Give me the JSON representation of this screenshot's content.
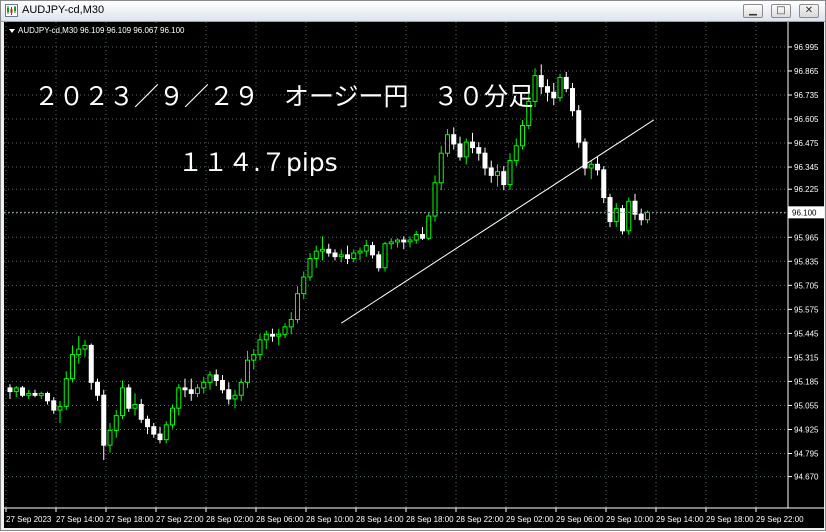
{
  "window": {
    "title": "AUDJPY-cd,M30",
    "buttons": {
      "minimize": "▁",
      "maximize": "□",
      "close": "✕"
    }
  },
  "chart_header": "AUDJPY-cd,M30  96.109 96.109 96.067 96.100",
  "annotations": {
    "title": "２０２３／９／２９　オージー円　３０分足",
    "pips": "１１４.７pips"
  },
  "colors": {
    "background": "#000000",
    "bull": "#00ff00",
    "bear": "#ffffff",
    "grid": "#5a6a6a",
    "axis_text": "#ffffff",
    "current_price_line": "#8a9aa0"
  },
  "chart_data": {
    "type": "candlestick",
    "symbol": "AUDJPY-cd",
    "timeframe": "M30",
    "ylim": [
      94.7,
      97.0
    ],
    "y_ticks": [
      "96.995",
      "96.865",
      "96.735",
      "96.605",
      "96.475",
      "96.345",
      "96.225",
      "96.095",
      "95.965",
      "95.835",
      "95.705",
      "95.575",
      "95.445",
      "95.315",
      "95.185",
      "95.055",
      "94.925",
      "94.795",
      "94.670"
    ],
    "x_ticks": [
      "27 Sep 2023",
      "27 Sep 14:00",
      "27 Sep 18:00",
      "27 Sep 22:00",
      "28 Sep 02:00",
      "28 Sep 06:00",
      "28 Sep 10:00",
      "28 Sep 14:00",
      "28 Sep 18:00",
      "28 Sep 22:00",
      "29 Sep 02:00",
      "29 Sep 06:00",
      "29 Sep 10:00",
      "29 Sep 14:00",
      "29 Sep 18:00",
      "29 Sep 22:00"
    ],
    "current_price": "96.100",
    "trend_line": {
      "from": {
        "time": "28 Sep 14:30",
        "price": 95.5
      },
      "to": {
        "time": "29 Sep 15:30",
        "price": 96.6
      }
    },
    "ohlc": [
      [
        95.15,
        95.17,
        95.09,
        95.13
      ],
      [
        95.13,
        95.16,
        95.1,
        95.15
      ],
      [
        95.15,
        95.16,
        95.1,
        95.11
      ],
      [
        95.11,
        95.14,
        95.09,
        95.12
      ],
      [
        95.12,
        95.14,
        95.1,
        95.11
      ],
      [
        95.11,
        95.13,
        95.09,
        95.12
      ],
      [
        95.12,
        95.13,
        95.06,
        95.08
      ],
      [
        95.08,
        95.1,
        95.01,
        95.03
      ],
      [
        95.03,
        95.08,
        94.96,
        95.05
      ],
      [
        95.05,
        95.24,
        95.03,
        95.2
      ],
      [
        95.2,
        95.38,
        95.18,
        95.33
      ],
      [
        95.33,
        95.43,
        95.28,
        95.36
      ],
      [
        95.36,
        95.41,
        95.32,
        95.38
      ],
      [
        95.38,
        95.39,
        95.14,
        95.18
      ],
      [
        95.18,
        95.2,
        95.08,
        95.11
      ],
      [
        95.11,
        95.14,
        94.76,
        94.84
      ],
      [
        94.84,
        94.96,
        94.8,
        94.92
      ],
      [
        94.92,
        95.03,
        94.88,
        95.0
      ],
      [
        95.0,
        95.19,
        94.98,
        95.15
      ],
      [
        95.15,
        95.17,
        95.02,
        95.04
      ],
      [
        95.04,
        95.12,
        95.0,
        95.06
      ],
      [
        95.06,
        95.09,
        94.96,
        94.98
      ],
      [
        94.98,
        95.0,
        94.9,
        94.94
      ],
      [
        94.94,
        94.96,
        94.88,
        94.9
      ],
      [
        94.9,
        94.94,
        94.85,
        94.87
      ],
      [
        94.87,
        94.97,
        94.85,
        94.95
      ],
      [
        94.95,
        95.06,
        94.93,
        95.04
      ],
      [
        95.04,
        95.17,
        95.0,
        95.15
      ],
      [
        95.15,
        95.2,
        95.1,
        95.14
      ],
      [
        95.14,
        95.2,
        95.08,
        95.12
      ],
      [
        95.12,
        95.17,
        95.1,
        95.15
      ],
      [
        95.15,
        95.21,
        95.12,
        95.18
      ],
      [
        95.18,
        95.24,
        95.14,
        95.22
      ],
      [
        95.22,
        95.25,
        95.16,
        95.19
      ],
      [
        95.19,
        95.22,
        95.12,
        95.14
      ],
      [
        95.14,
        95.18,
        95.06,
        95.09
      ],
      [
        95.09,
        95.14,
        95.04,
        95.11
      ],
      [
        95.11,
        95.2,
        95.08,
        95.18
      ],
      [
        95.18,
        95.35,
        95.15,
        95.3
      ],
      [
        95.3,
        95.36,
        95.25,
        95.33
      ],
      [
        95.33,
        95.44,
        95.3,
        95.41
      ],
      [
        95.41,
        95.46,
        95.36,
        95.44
      ],
      [
        95.44,
        95.47,
        95.4,
        95.43
      ],
      [
        95.43,
        95.47,
        95.38,
        95.44
      ],
      [
        95.44,
        95.5,
        95.42,
        95.48
      ],
      [
        95.48,
        95.56,
        95.44,
        95.52
      ],
      [
        95.52,
        95.7,
        95.5,
        95.66
      ],
      [
        95.66,
        95.78,
        95.63,
        95.75
      ],
      [
        95.75,
        95.88,
        95.73,
        95.85
      ],
      [
        95.85,
        95.92,
        95.8,
        95.89
      ],
      [
        95.89,
        95.97,
        95.84,
        95.9
      ],
      [
        95.9,
        95.93,
        95.86,
        95.88
      ],
      [
        95.88,
        95.9,
        95.84,
        95.86
      ],
      [
        95.86,
        95.9,
        95.83,
        95.87
      ],
      [
        95.87,
        95.92,
        95.82,
        95.85
      ],
      [
        95.85,
        95.9,
        95.83,
        95.88
      ],
      [
        95.88,
        95.91,
        95.84,
        95.89
      ],
      [
        95.89,
        95.95,
        95.86,
        95.92
      ],
      [
        95.92,
        95.94,
        95.85,
        95.87
      ],
      [
        95.87,
        95.89,
        95.78,
        95.8
      ],
      [
        95.8,
        95.94,
        95.78,
        95.93
      ],
      [
        95.93,
        95.96,
        95.9,
        95.94
      ],
      [
        95.94,
        95.96,
        95.91,
        95.95
      ],
      [
        95.95,
        95.97,
        95.9,
        95.94
      ],
      [
        95.94,
        95.97,
        95.91,
        95.95
      ],
      [
        95.95,
        96.0,
        95.93,
        95.98
      ],
      [
        95.98,
        96.02,
        95.95,
        95.96
      ],
      [
        95.96,
        96.1,
        95.95,
        96.08
      ],
      [
        96.08,
        96.3,
        96.05,
        96.26
      ],
      [
        96.26,
        96.46,
        96.22,
        96.42
      ],
      [
        96.42,
        96.55,
        96.4,
        96.52
      ],
      [
        96.52,
        96.56,
        96.44,
        96.47
      ],
      [
        96.47,
        96.51,
        96.38,
        96.4
      ],
      [
        96.4,
        96.5,
        96.36,
        96.48
      ],
      [
        96.48,
        96.53,
        96.42,
        96.45
      ],
      [
        96.45,
        96.48,
        96.38,
        96.42
      ],
      [
        96.42,
        96.45,
        96.3,
        96.34
      ],
      [
        96.34,
        96.38,
        96.26,
        96.3
      ],
      [
        96.3,
        96.36,
        96.24,
        96.32
      ],
      [
        96.32,
        96.35,
        96.22,
        96.25
      ],
      [
        96.25,
        96.42,
        96.22,
        96.38
      ],
      [
        96.38,
        96.5,
        96.35,
        96.46
      ],
      [
        96.46,
        96.6,
        96.44,
        96.57
      ],
      [
        96.57,
        96.74,
        96.55,
        96.7
      ],
      [
        96.7,
        96.88,
        96.67,
        96.84
      ],
      [
        96.84,
        96.9,
        96.74,
        96.78
      ],
      [
        96.78,
        96.82,
        96.7,
        96.75
      ],
      [
        96.75,
        96.8,
        96.68,
        96.72
      ],
      [
        96.72,
        96.85,
        96.7,
        96.83
      ],
      [
        96.83,
        96.86,
        96.75,
        96.77
      ],
      [
        96.77,
        96.8,
        96.62,
        96.65
      ],
      [
        96.65,
        96.68,
        96.45,
        96.48
      ],
      [
        96.48,
        96.5,
        96.3,
        96.34
      ],
      [
        96.34,
        96.38,
        96.28,
        96.36
      ],
      [
        96.36,
        96.4,
        96.3,
        96.33
      ],
      [
        96.33,
        96.35,
        96.15,
        96.18
      ],
      [
        96.18,
        96.2,
        96.02,
        96.05
      ],
      [
        96.05,
        96.15,
        96.02,
        96.12
      ],
      [
        96.12,
        96.14,
        95.98,
        96.0
      ],
      [
        96.0,
        96.18,
        95.98,
        96.16
      ],
      [
        96.16,
        96.2,
        96.06,
        96.09
      ],
      [
        96.09,
        96.12,
        96.03,
        96.06
      ],
      [
        96.06,
        96.11,
        96.04,
        96.1
      ]
    ]
  }
}
